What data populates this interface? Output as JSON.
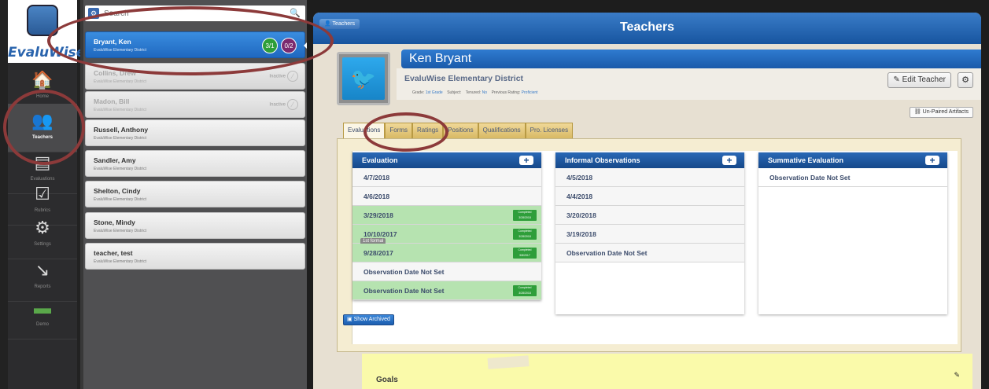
{
  "app": {
    "brand": "EvaluWise"
  },
  "nav": [
    {
      "label": "Home",
      "icon": "home-icon",
      "glyph": "🏠"
    },
    {
      "label": "Teachers",
      "icon": "teachers-icon",
      "glyph": "👥"
    },
    {
      "label": "Evaluations",
      "icon": "evaluations-icon",
      "glyph": "▤"
    },
    {
      "label": "Rubrics",
      "icon": "rubrics-icon",
      "glyph": "☑"
    },
    {
      "label": "Settings",
      "icon": "settings-icon",
      "glyph": "⚙"
    },
    {
      "label": "Reports",
      "icon": "reports-icon",
      "glyph": "↘"
    },
    {
      "label": "Demo",
      "icon": "demo-icon",
      "glyph": "▬"
    }
  ],
  "search": {
    "placeholder": "Search"
  },
  "teachers": [
    {
      "name": "Bryant, Ken",
      "district": "EvaluWise Elementary District",
      "badge1": "3/1",
      "badge2": "0/2"
    },
    {
      "name": "Collins, Drew",
      "district": "EvaluWise Elementary District",
      "status": "Inactive"
    },
    {
      "name": "Madon, Bill",
      "district": "EvaluWise Elementary District",
      "status": "Inactive"
    },
    {
      "name": "Russell, Anthony",
      "district": "EvaluWise Elementary District"
    },
    {
      "name": "Sandler, Amy",
      "district": "EvaluWise Elementary District"
    },
    {
      "name": "Shelton, Cindy",
      "district": "EvaluWise Elementary District"
    },
    {
      "name": "Stone, Mindy",
      "district": "EvaluWise Elementary District"
    },
    {
      "name": "teacher, test",
      "district": "EvaluWise Elementary District"
    }
  ],
  "header": {
    "title": "Teachers",
    "crumb": "Teachers"
  },
  "profile": {
    "name": "Ken Bryant",
    "district": "EvaluWise Elementary District",
    "grade_label": "Grade:",
    "grade": "1st Grade",
    "subject_label": "Subject:",
    "tenured_label": "Tenured:",
    "tenured": "No",
    "rating_label": "Previous Rating:",
    "rating": "Proficient",
    "edit_label": "Edit Teacher",
    "unpaired_label": "Un-Paired Artifacts"
  },
  "tabs": [
    "Evaluations",
    "Forms",
    "Ratings",
    "Positions",
    "Qualifications",
    "Pro. Licenses"
  ],
  "columns": {
    "evaluation": {
      "title": "Evaluation",
      "rows": [
        {
          "date": "4/7/2018"
        },
        {
          "date": "4/6/2018"
        },
        {
          "date": "3/29/2018",
          "completed": "Completed 3/28/2018"
        },
        {
          "date": "10/10/2017",
          "completed": "Completed 3/28/2018",
          "tag": "1st formal"
        },
        {
          "date": "9/28/2017",
          "completed": "Completed 9/8/2017"
        },
        {
          "date": "Observation Date Not Set"
        },
        {
          "date": "Observation Date Not Set",
          "completed": "Completed 3/28/2018"
        }
      ]
    },
    "informal": {
      "title": "Informal Observations",
      "rows": [
        {
          "date": "4/5/2018"
        },
        {
          "date": "4/4/2018"
        },
        {
          "date": "3/20/2018"
        },
        {
          "date": "3/19/2018"
        },
        {
          "date": "Observation Date Not Set"
        }
      ]
    },
    "summative": {
      "title": "Summative Evaluation",
      "rows": [
        {
          "date": "Observation Date Not Set"
        }
      ]
    }
  },
  "show_archived": "Show Archived",
  "goals": {
    "label": "Goals"
  }
}
